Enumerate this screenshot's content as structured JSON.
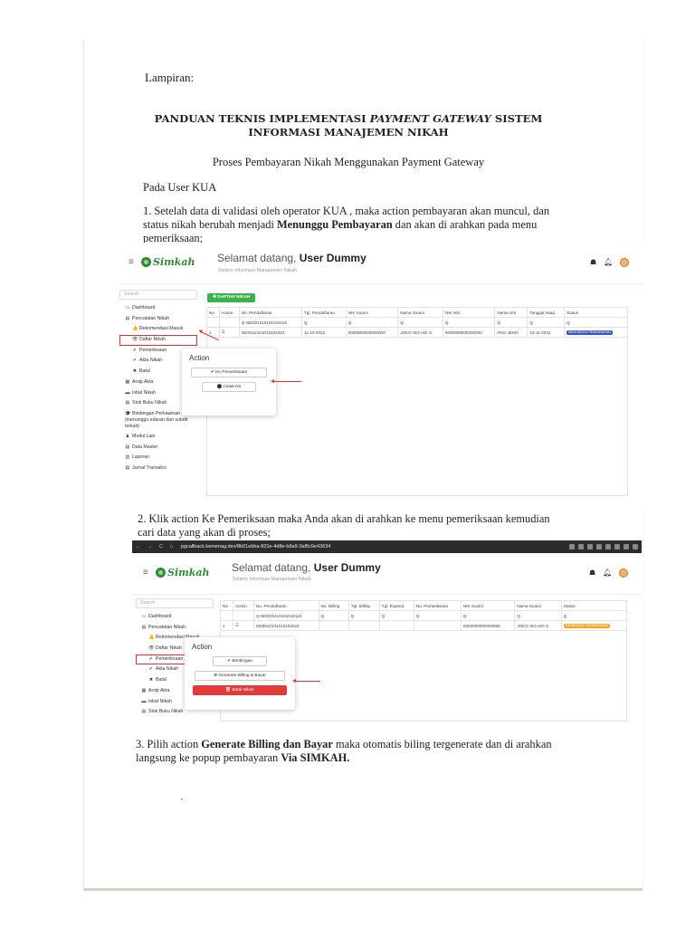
{
  "doc": {
    "lampiran": "Lampiran:",
    "title_part1": "PANDUAN TEKNIS IMPLEMENTASI ",
    "title_italic": "PAYMENT GATEWAY",
    "title_part2": " SISTEM INFORMASI MANAJEMEN NIKAH",
    "subtitle": "Proses Pembayaran Nikah Menggunakan Payment Gateway",
    "section": "Pada User KUA",
    "step1_a": "1.  Setelah data di validasi oleh operator KUA , maka action pembayaran akan muncul, dan status nikah berubah menjadi ",
    "step1_bold": "Menunggu Pembayaran",
    "step1_b": " dan akan di arahkan pada menu pemeriksaan;",
    "step2": "2.  Klik action Ke Pemeriksaan maka Anda akan di arahkan ke menu pemeriksaan kemudian cari data yang akan di proses;",
    "step3_a": "3.  Pilih action ",
    "step3_bold1": "Generate Billing dan Bayar",
    "step3_b": " maka otomatis biling tergenerate dan di arahkan langsung ke popup pembayaran ",
    "step3_bold2": "Via SIMKAH."
  },
  "app": {
    "logo": "Simkah",
    "welcome": "Selamat datang, ",
    "user": "User Dummy",
    "system_name": "Sistem Informasi Manajemen Nikah",
    "search_placeholder": "Search",
    "url": "pgcallback.kemenag.dev/8b01ebba-821e-4d8e-b8a9-3af5c9e43634"
  },
  "shot1": {
    "sidebar": [
      {
        "label": "Dashboard",
        "icon": "▭",
        "sub": false
      },
      {
        "label": "Pencatatan Nikah",
        "icon": "▤",
        "sub": false
      },
      {
        "label": "Rekomendasi Masuk",
        "icon": "👍",
        "sub": true
      },
      {
        "label": "Daftar Nikah",
        "icon": "👁",
        "sub": true,
        "selected": true
      },
      {
        "label": "Pemeriksaan",
        "icon": "✔",
        "sub": true
      },
      {
        "label": "Akta Nikah",
        "icon": "✔",
        "sub": true
      },
      {
        "label": "Batal",
        "icon": "✖",
        "sub": true
      },
      {
        "label": "Arsip Akta",
        "icon": "▦",
        "sub": false
      },
      {
        "label": "Isbat Nikah",
        "icon": "▬",
        "sub": false
      },
      {
        "label": "Stok Buku Nikah",
        "icon": "▤",
        "sub": false
      },
      {
        "label": "Bimbingan Perkawinan (menunggu edaran dari subdit terkait)",
        "icon": "🎓",
        "sub": false,
        "wrap": true
      },
      {
        "label": "Modul Lain",
        "icon": "♟",
        "sub": false
      },
      {
        "label": "Data Master",
        "icon": "▤",
        "sub": false
      },
      {
        "label": "Laporan",
        "icon": "▥",
        "sub": false
      },
      {
        "label": "Jurnal Transaksi",
        "icon": "▤",
        "sub": false
      }
    ],
    "add_button": "DAFTAR NIKAH",
    "columns": [
      "No",
      "Action",
      "No. Pendaftaran",
      "Tgl. Pendaftaran",
      "NIK Suami",
      "Nama Suami",
      "NIK Istri",
      "Nama Istri",
      "Tanggal Akad",
      "Status"
    ],
    "filter": [
      "",
      "",
      "Q  NDD01210101010110",
      "Q",
      "Q",
      "Q",
      "Q",
      "Q",
      "Q",
      "Q"
    ],
    "row": [
      "1",
      "☰",
      "ND0012101010102023",
      "11-10-2022",
      "0000000000000000",
      "JOKO SIO ADI S",
      "0000000000000000",
      "FINA JEMA",
      "23-11-2022",
      "MENUNGGU PEMBAYARAN"
    ],
    "popup_title": "Action",
    "popup_buttons": [
      "✔  Ke Pemeriksaan",
      "⬤  Cetak N1"
    ]
  },
  "shot2": {
    "sidebar": [
      {
        "label": "Dashboard",
        "icon": "▭",
        "sub": false
      },
      {
        "label": "Pencatatan Nikah",
        "icon": "▤",
        "sub": false
      },
      {
        "label": "Rekomendasi Masuk",
        "icon": "👍",
        "sub": true
      },
      {
        "label": "Daftar Nikah",
        "icon": "👁",
        "sub": true
      },
      {
        "label": "Pemeriksaan",
        "icon": "✔",
        "sub": true,
        "selected": true
      },
      {
        "label": "Akta Nikah",
        "icon": "✔",
        "sub": true
      },
      {
        "label": "Batal",
        "icon": "✖",
        "sub": true
      },
      {
        "label": "Arsip Akta",
        "icon": "▦",
        "sub": false
      },
      {
        "label": "Isbat Nikah",
        "icon": "▬",
        "sub": false
      },
      {
        "label": "Stok Buku Nikah",
        "icon": "▤",
        "sub": false
      }
    ],
    "columns": [
      "No",
      "Action",
      "No. Pendaftaran",
      "No. Billing",
      "Tgl. Billing",
      "Tgl. Expired",
      "No. Pemeriksaan",
      "NIK Suami",
      "Nama Suami",
      "Status"
    ],
    "filter": [
      "",
      "",
      "Q  NDD01210101010110",
      "Q",
      "Q",
      "Q",
      "Q",
      "Q",
      "Q",
      "Q"
    ],
    "row": [
      "1",
      "☰",
      "ND0012101010102023",
      "",
      "",
      "",
      "",
      "0000000000000000",
      "JOKO SIO ADI S",
      "MENUNGGU PEMBAYARAN"
    ],
    "popup_title": "Action",
    "popup_buttons": [
      "✔  Bimbingan",
      "⊕  Generate Billing & Bayar"
    ],
    "popup_danger": "🗑  Batal Nikah"
  }
}
